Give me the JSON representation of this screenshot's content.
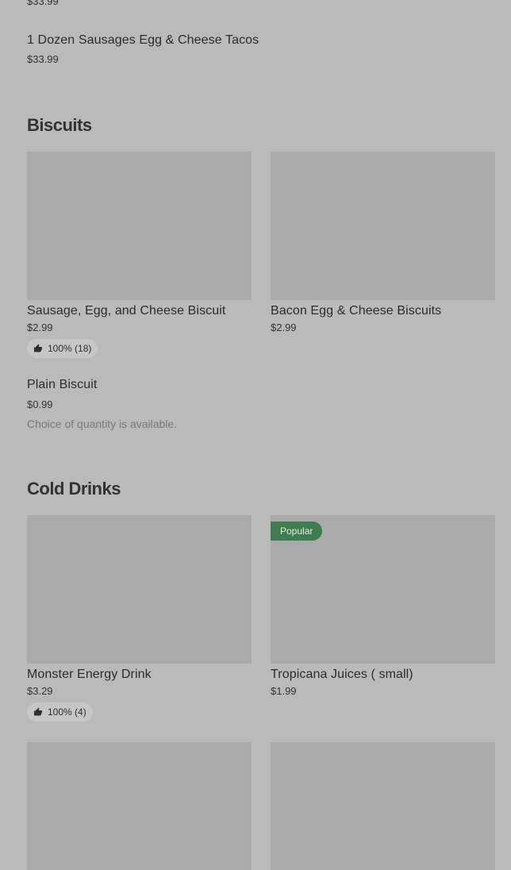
{
  "top_item": {
    "price": "$33.99"
  },
  "tacos_item": {
    "name": "1 Dozen Sausages Egg & Cheese Tacos",
    "price": "$33.99"
  },
  "sections": [
    {
      "title": "Biscuits",
      "cards": [
        {
          "name": "Sausage, Egg, and Cheese Biscuit",
          "price": "$2.99",
          "rating": "100% (18)"
        },
        {
          "name": "Bacon Egg & Cheese Biscuits",
          "price": "$2.99"
        }
      ],
      "list_item": {
        "name": "Plain Biscuit",
        "price": "$0.99",
        "note": "Choice of quantity is available."
      }
    },
    {
      "title": "Cold Drinks",
      "cards": [
        {
          "name": "Monster Energy Drink",
          "price": "$3.29",
          "rating": "100% (4)"
        },
        {
          "name": "Tropicana  Juices  ( small)",
          "price": "$1.99",
          "badge": "Popular"
        }
      ]
    }
  ],
  "colors": {
    "background": "#bababa",
    "image_placeholder": "#aaaaaa",
    "badge": "#3d7d4f",
    "rating_pill": "#c6c6c6"
  },
  "icons": {
    "rating": "thumbs-up-icon"
  }
}
